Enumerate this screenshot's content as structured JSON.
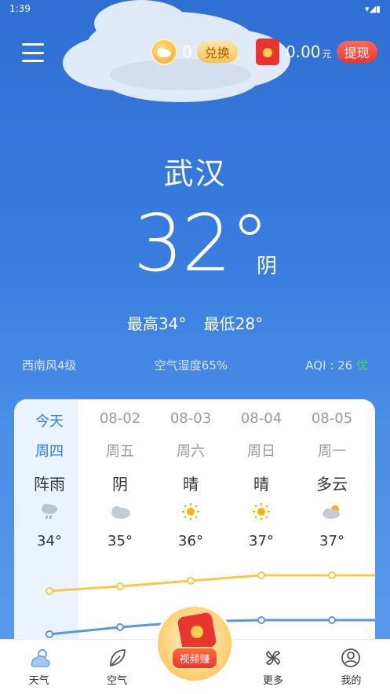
{
  "status": {
    "time": "1:39",
    "right_icons": "▾◢▮"
  },
  "header": {
    "coins": "0",
    "exchange_label": "兑换",
    "cash": "0.00",
    "cash_unit": "元",
    "withdraw_label": "提现"
  },
  "weather": {
    "city": "武汉",
    "temp": "32°",
    "condition": "阴",
    "high": "最高34°",
    "low": "最低28°",
    "wind": "西南风4级",
    "humidity": "空气湿度65%",
    "aqi_label": "AQI : 26",
    "aqi_level": "优"
  },
  "forecast": [
    {
      "date": "今天",
      "week": "周四",
      "wx": "阵雨",
      "hi": "34°",
      "icon": "rain-icon"
    },
    {
      "date": "08-02",
      "week": "周五",
      "wx": "阴",
      "hi": "35°",
      "icon": "cloud-icon"
    },
    {
      "date": "08-03",
      "week": "周六",
      "wx": "晴",
      "hi": "36°",
      "icon": "sun-icon"
    },
    {
      "date": "08-04",
      "week": "周日",
      "wx": "晴",
      "hi": "37°",
      "icon": "sun-icon"
    },
    {
      "date": "08-05",
      "week": "周一",
      "wx": "多云",
      "hi": "37°",
      "icon": "partly-cloudy-icon"
    }
  ],
  "nav": {
    "weather": "天气",
    "air": "空气",
    "video": "视频赚",
    "more": "更多",
    "mine": "我的"
  },
  "colors": {
    "accent": "#2f7de1",
    "high_line": "#f7c84a",
    "low_line": "#5a95e6"
  }
}
